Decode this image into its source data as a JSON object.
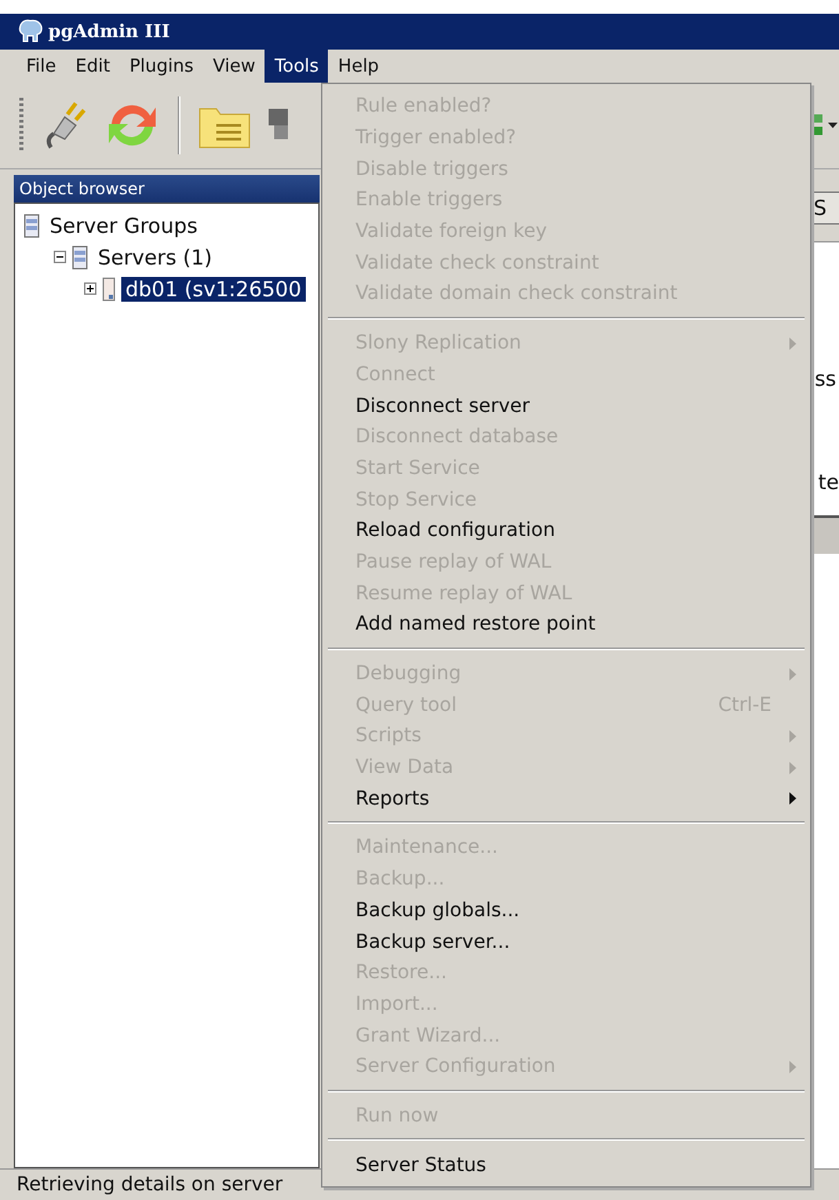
{
  "window": {
    "title": "pgAdmin III"
  },
  "menu_bar": [
    {
      "label": "File",
      "selected": false
    },
    {
      "label": "Edit",
      "selected": false
    },
    {
      "label": "Plugins",
      "selected": false
    },
    {
      "label": "View",
      "selected": false
    },
    {
      "label": "Tools",
      "selected": true
    },
    {
      "label": "Help",
      "selected": false
    }
  ],
  "object_browser": {
    "title": "Object browser",
    "tree": [
      {
        "label": "Server Groups",
        "kind": "group",
        "selected": false,
        "children": [
          {
            "label": "Servers (1)",
            "kind": "servers",
            "expanded": true,
            "selected": false,
            "children": [
              {
                "label": "db01 (sv1:26500",
                "kind": "server",
                "expanded": false,
                "selected": true
              }
            ]
          }
        ]
      }
    ]
  },
  "right_panel": {
    "button": "S",
    "text_1": "ss",
    "text_2": "te"
  },
  "tools_menu": [
    [
      {
        "label": "Rule enabled?",
        "disabled": true
      },
      {
        "label": "Trigger enabled?",
        "disabled": true
      },
      {
        "label": "Disable triggers",
        "disabled": true
      },
      {
        "label": "Enable triggers",
        "disabled": true
      },
      {
        "label": "Validate foreign key",
        "disabled": true
      },
      {
        "label": "Validate check constraint",
        "disabled": true
      },
      {
        "label": "Validate domain check constraint",
        "disabled": true
      }
    ],
    [
      {
        "label": "Slony Replication",
        "disabled": true,
        "submenu": true
      },
      {
        "label": "Connect",
        "disabled": true
      },
      {
        "label": "Disconnect server",
        "disabled": false
      },
      {
        "label": "Disconnect database",
        "disabled": true
      },
      {
        "label": "Start Service",
        "disabled": true
      },
      {
        "label": "Stop Service",
        "disabled": true
      },
      {
        "label": "Reload configuration",
        "disabled": false
      },
      {
        "label": "Pause replay of WAL",
        "disabled": true
      },
      {
        "label": "Resume replay of WAL",
        "disabled": true
      },
      {
        "label": "Add named restore point",
        "disabled": false
      }
    ],
    [
      {
        "label": "Debugging",
        "disabled": true,
        "submenu": true
      },
      {
        "label": "Query tool",
        "disabled": true,
        "shortcut": "Ctrl-E"
      },
      {
        "label": "Scripts",
        "disabled": true,
        "submenu": true
      },
      {
        "label": "View Data",
        "disabled": true,
        "submenu": true
      },
      {
        "label": "Reports",
        "disabled": false,
        "submenu": true
      }
    ],
    [
      {
        "label": "Maintenance...",
        "disabled": true
      },
      {
        "label": "Backup...",
        "disabled": true
      },
      {
        "label": "Backup globals...",
        "disabled": false
      },
      {
        "label": "Backup server...",
        "disabled": false
      },
      {
        "label": "Restore...",
        "disabled": true
      },
      {
        "label": "Import...",
        "disabled": true
      },
      {
        "label": "Grant Wizard...",
        "disabled": true
      },
      {
        "label": "Server Configuration",
        "disabled": true,
        "submenu": true
      }
    ],
    [
      {
        "label": "Run now",
        "disabled": true
      }
    ],
    [
      {
        "label": "Server Status",
        "disabled": false
      }
    ]
  ],
  "status_bar": "Retrieving details on server"
}
